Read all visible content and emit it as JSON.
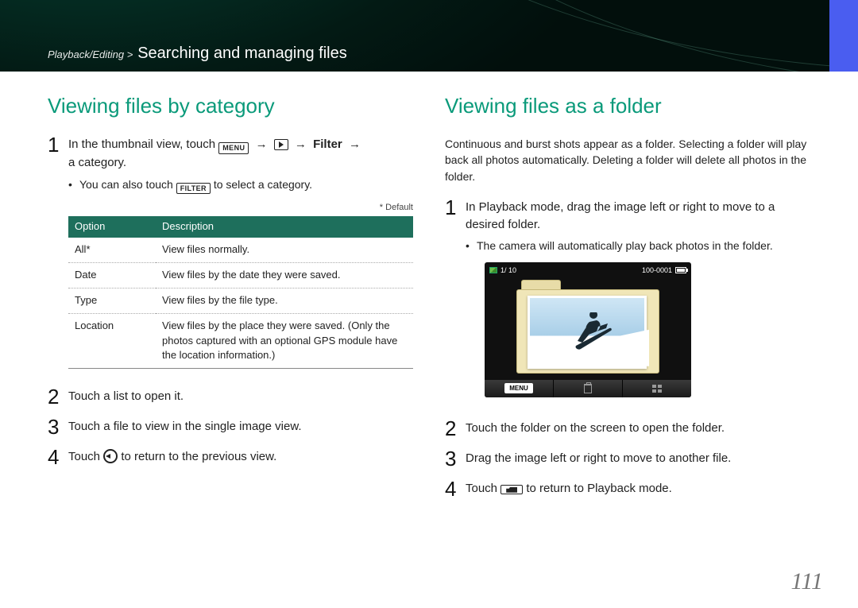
{
  "breadcrumb": {
    "section": "Playback/Editing >",
    "title": "Searching and managing files"
  },
  "left": {
    "heading": "Viewing files by category",
    "step1_a": "In the thumbnail view, touch ",
    "menu_badge": "MENU",
    "arrow": "→",
    "filter_word": "Filter",
    "step1_b": "a category.",
    "bullet1_a": "You can also touch ",
    "filter_badge": "FILTER",
    "bullet1_b": " to select a category.",
    "default_note": "* Default",
    "table": {
      "headers": [
        "Option",
        "Description"
      ],
      "rows": [
        {
          "opt": "All*",
          "desc": "View files normally."
        },
        {
          "opt": "Date",
          "desc": "View files by the date they were saved."
        },
        {
          "opt": "Type",
          "desc": "View files by the file type."
        },
        {
          "opt": "Location",
          "desc": "View files by the place they were saved. (Only the photos captured with an optional GPS module have the location information.)"
        }
      ]
    },
    "step2": "Touch a list to open it.",
    "step3": "Touch a file to view in the single image view.",
    "step4_a": "Touch ",
    "step4_b": " to return to the previous view."
  },
  "right": {
    "heading": "Viewing files as a folder",
    "intro": "Continuous and burst shots appear as a folder. Selecting a folder will play back all photos automatically. Deleting a folder will delete all photos in the folder.",
    "step1": "In Playback mode, drag the image left or right to move to a desired folder.",
    "bullet1": "The camera will automatically play back photos in the folder.",
    "screen": {
      "counter": "1/ 10",
      "fileno": "100-0001",
      "menu_label": "MENU"
    },
    "step2": "Touch the folder on the screen to open the folder.",
    "step3": "Drag the image left or right to move to another file.",
    "step4_a": "Touch ",
    "step4_b": " to return to Playback mode."
  },
  "page_number": "111"
}
